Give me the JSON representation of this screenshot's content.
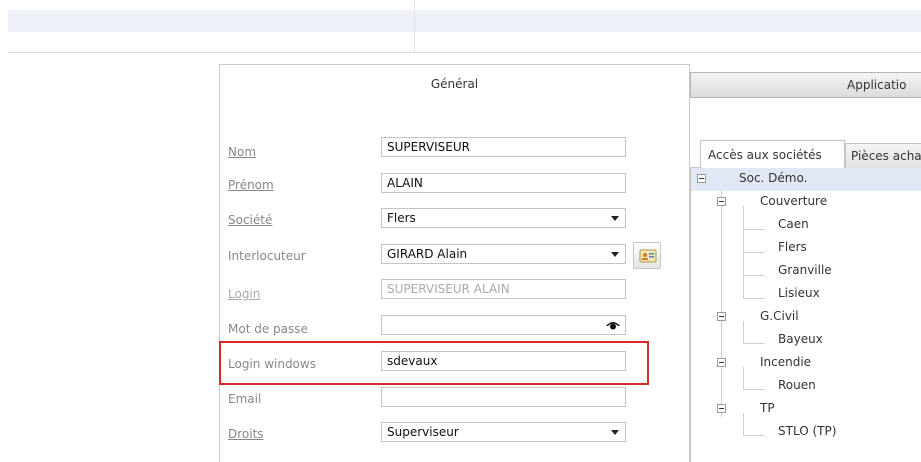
{
  "panel": {
    "title": "Général"
  },
  "tabs": {
    "applications": "Applicatio",
    "acces": "Accès aux sociétés",
    "pieces": "Pièces acha"
  },
  "form": {
    "nom": {
      "label": "Nom",
      "value": "SUPERVISEUR"
    },
    "prenom": {
      "label": "Prénom",
      "value": "ALAIN"
    },
    "societe": {
      "label": "Société",
      "value": "Flers"
    },
    "interlocuteur": {
      "label": "Interlocuteur",
      "value": "GIRARD Alain"
    },
    "login": {
      "label": "Login",
      "value": "SUPERVISEUR ALAIN"
    },
    "mot_de_passe": {
      "label": "Mot de passe",
      "value": ""
    },
    "login_windows": {
      "label": "Login windows",
      "value": "sdevaux"
    },
    "email": {
      "label": "Email",
      "value": ""
    },
    "droits": {
      "label": "Droits",
      "value": "Superviseur"
    }
  },
  "tree": {
    "root": "Soc. Démo.",
    "groups": [
      {
        "label": "Couverture",
        "children": [
          "Caen",
          "Flers",
          "Granville",
          "Lisieux"
        ]
      },
      {
        "label": "G.Civil",
        "children": [
          "Bayeux"
        ]
      },
      {
        "label": "Incendie",
        "children": [
          "Rouen"
        ]
      },
      {
        "label": "TP",
        "children": [
          "STLO (TP)"
        ]
      }
    ]
  },
  "colors": {
    "highlight": "#d42a2a",
    "tree_root_bg": "#dfe8f4"
  },
  "icons": {
    "dropdown": "chevron-down-icon",
    "password": "eye-icon",
    "contact": "contact-card-icon"
  }
}
